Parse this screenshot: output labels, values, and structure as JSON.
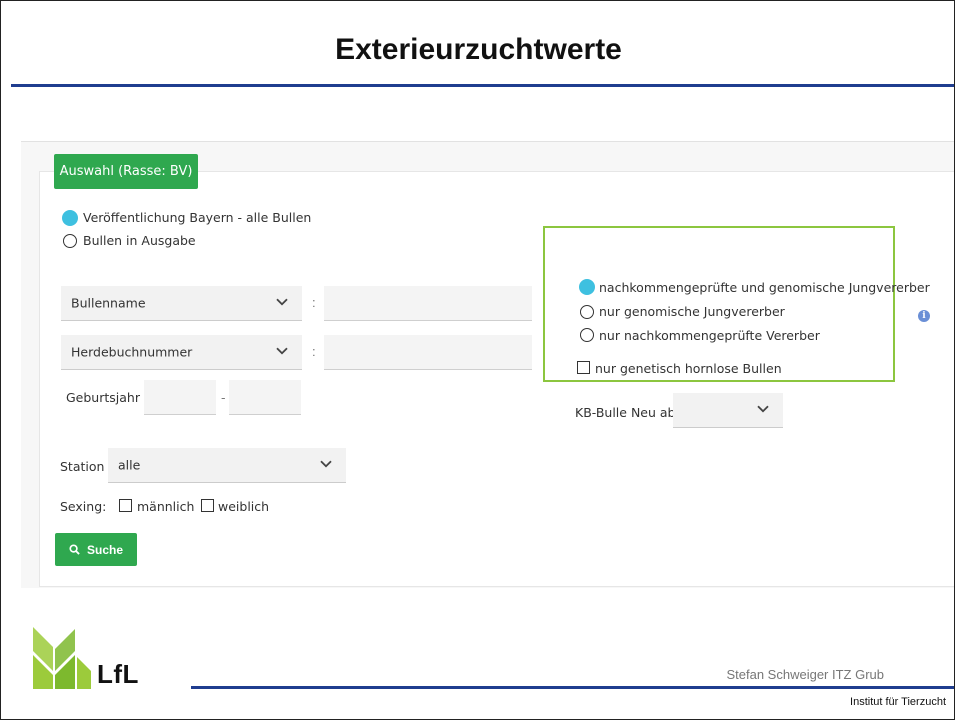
{
  "slide": {
    "title": "Exterieurzuchtwerte",
    "footer_author": "Stefan Schweiger ITZ Grub",
    "footer_institute": "Institut für Tierzucht",
    "logo_text": "LfL"
  },
  "form": {
    "tab_label": "Auswahl (Rasse: BV)",
    "publication": [
      {
        "label": "Veröffentlichung Bayern - alle Bullen",
        "selected": true
      },
      {
        "label": "Bullen in Ausgabe",
        "selected": false
      }
    ],
    "bullenname_select": "Bullenname",
    "herdebuch_select": "Herdebuchnummer",
    "colon": ":",
    "geburtsjahr_label": "Geburtsjahr",
    "dash": "-",
    "station_label": "Station",
    "station_value": "alle",
    "sexing_label": "Sexing:",
    "sexing_options": [
      {
        "label": "männlich",
        "checked": false
      },
      {
        "label": "weiblich",
        "checked": false
      }
    ],
    "search_label": "Suche",
    "test_type": [
      {
        "label": "nachkommengeprüfte und genomische Jungvererber",
        "selected": true
      },
      {
        "label": "nur genomische Jungvererber",
        "selected": false
      },
      {
        "label": "nur nachkommengeprüfte Vererber",
        "selected": false
      }
    ],
    "hornless_label": "nur genetisch hornlose Bullen",
    "kb_label": "KB-Bulle Neu ab",
    "info_glyph": "i"
  },
  "colors": {
    "accent_green": "#2fa84f",
    "radio_selected": "#3ec0e0",
    "highlight_box": "#8cc63f",
    "rule_blue": "#1f3d8f"
  }
}
